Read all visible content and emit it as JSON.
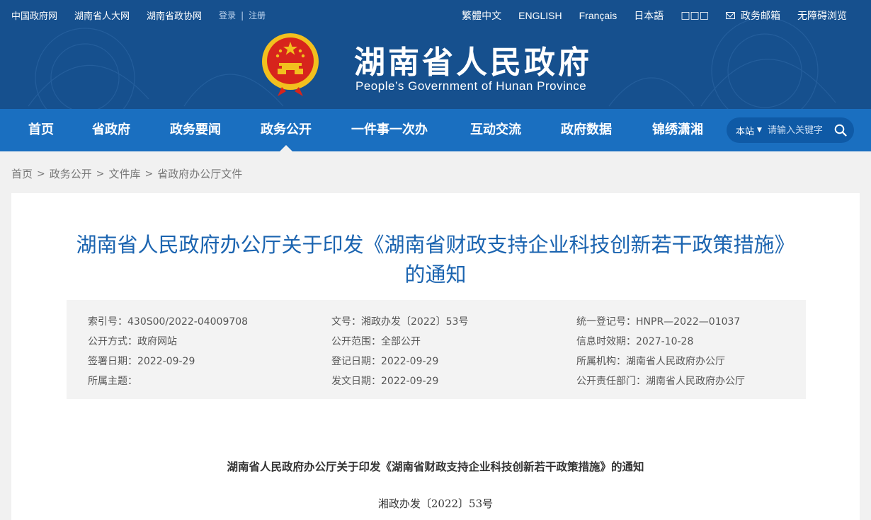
{
  "top_left": {
    "links": [
      "中国政府网",
      "湖南省人大网",
      "湖南省政协网"
    ],
    "login": "登录",
    "separator": "|",
    "register": "注册"
  },
  "top_right": {
    "traditional": "繁體中文",
    "english": "ENGLISH",
    "french": "Français",
    "japanese": "日本語",
    "other_lang": "□□□",
    "mailbox": "政务邮箱",
    "accessibility": "无障碍浏览"
  },
  "site": {
    "title": "湖南省人民政府",
    "subtitle": "People’s Government of Hunan Province"
  },
  "nav": {
    "items": [
      "首页",
      "省政府",
      "政务要闻",
      "政务公开",
      "一件事一次办",
      "互动交流",
      "政府数据",
      "锦绣潇湘"
    ],
    "active": "政务公开"
  },
  "search": {
    "scope": "本站",
    "placeholder": "请输入关键字"
  },
  "breadcrumb": [
    "首页",
    "政务公开",
    "文件库",
    "省政府办公厅文件"
  ],
  "document": {
    "title_line1": "湖南省人民政府办公厅关于印发《湖南省财政支持企业科技创新若干政策措施》",
    "title_line2": "的通知",
    "meta": {
      "index_no": "索引号：430S00/2022-04009708",
      "doc_no": "文号：湘政办发〔2022〕53号",
      "unified_reg_no": "统一登记号：HNPR—2022—01037",
      "publish_method": "公开方式：政府网站",
      "publish_scope": "公开范围：全部公开",
      "validity": "信息时效期：2027-10-28",
      "sign_date": "签署日期：2022-09-29",
      "reg_date": "登记日期：2022-09-29",
      "agency": "所属机构：湖南省人民政府办公厅",
      "theme": "所属主题：",
      "issue_date": "发文日期：2022-09-29",
      "responsible_dept": "公开责任部门：湖南省人民政府办公厅"
    },
    "body_title": "湖南省人民政府办公厅关于印发《湖南省财政支持企业科技创新若干政策措施》的通知",
    "body_doc_no": "湘政办发〔2022〕53号"
  },
  "colors": {
    "header_bg": "#16508e",
    "nav_bg": "#1a6fc0",
    "title_blue": "#1b64b0",
    "emblem_red": "#d7241c",
    "emblem_gold": "#f2c01e"
  }
}
